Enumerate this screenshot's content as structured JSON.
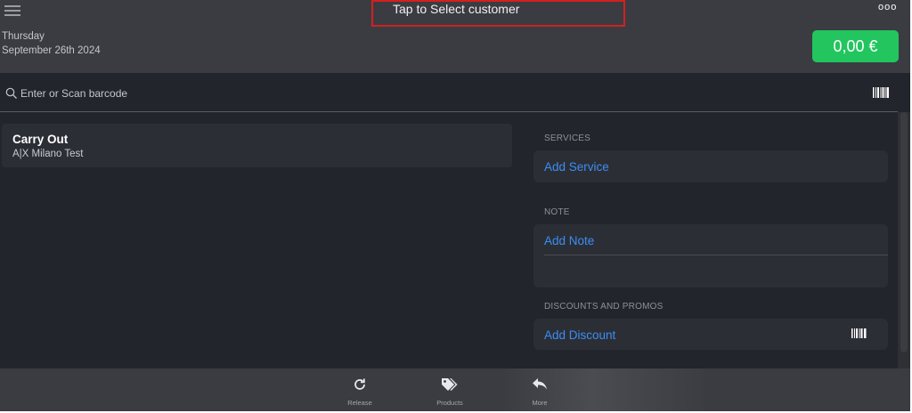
{
  "header": {
    "customer_prompt": "Tap to Select customer",
    "more_label": "ooo",
    "weekday": "Thursday",
    "date": "September 26th 2024",
    "total": "0,00 €"
  },
  "search": {
    "placeholder": "Enter or Scan barcode"
  },
  "order": {
    "type": "Carry Out",
    "store": "A|X Milano Test"
  },
  "services": {
    "label": "SERVICES",
    "action": "Add Service"
  },
  "note": {
    "label": "NOTE",
    "action": "Add Note"
  },
  "discounts": {
    "label": "DISCOUNTS AND PROMOS",
    "action": "Add Discount"
  },
  "bottom_nav": {
    "items": [
      {
        "label": "Release",
        "icon": "refresh-icon"
      },
      {
        "label": "Products",
        "icon": "tags-icon"
      },
      {
        "label": "More",
        "icon": "reply-icon"
      }
    ]
  },
  "colors": {
    "accent": "#3b8ef5",
    "total_button": "#22c55e",
    "highlight_border": "#d32020"
  }
}
